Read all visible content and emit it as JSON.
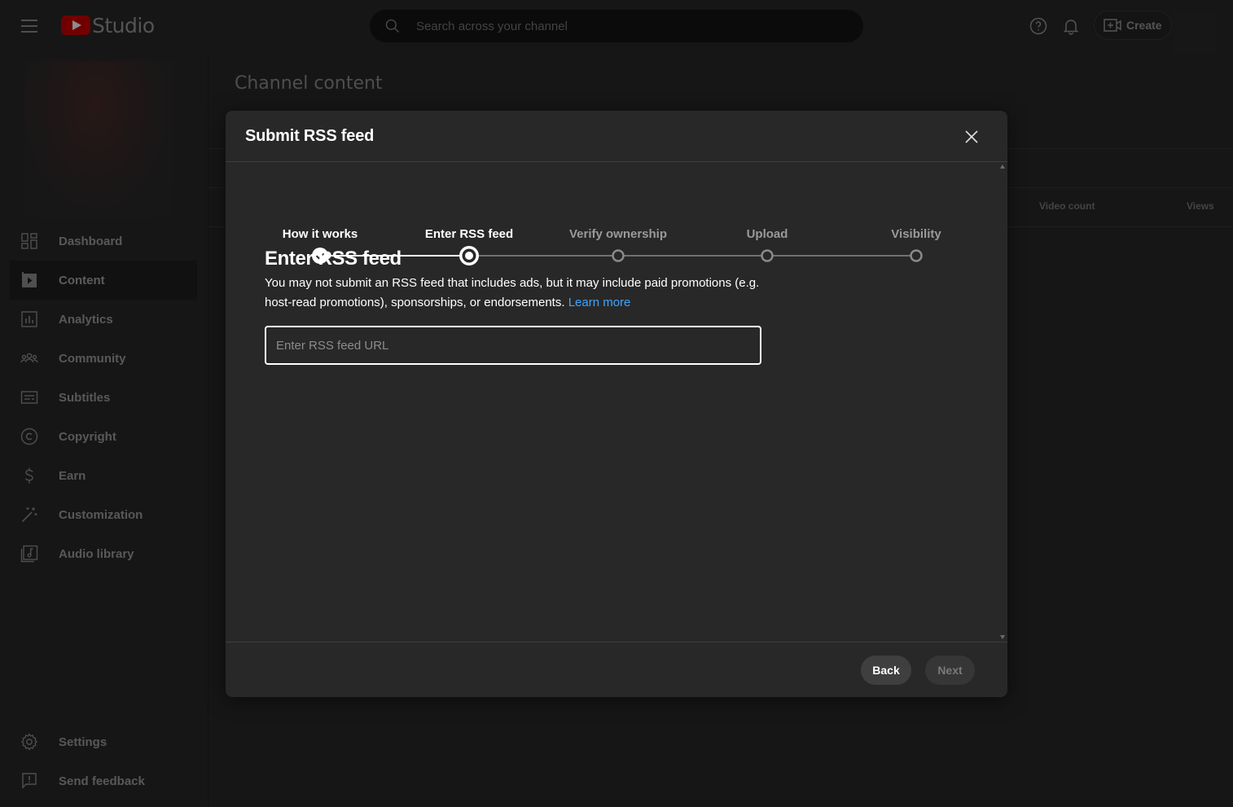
{
  "header": {
    "logo_text": "Studio",
    "search_placeholder": "Search across your channel",
    "create_label": "Create"
  },
  "sidebar": {
    "items": [
      {
        "label": "Dashboard",
        "icon": "dashboard-icon"
      },
      {
        "label": "Content",
        "icon": "content-icon",
        "active": true
      },
      {
        "label": "Analytics",
        "icon": "analytics-icon"
      },
      {
        "label": "Community",
        "icon": "community-icon"
      },
      {
        "label": "Subtitles",
        "icon": "subtitles-icon"
      },
      {
        "label": "Copyright",
        "icon": "copyright-icon"
      },
      {
        "label": "Earn",
        "icon": "dollar-icon"
      },
      {
        "label": "Customization",
        "icon": "magic-wand-icon"
      },
      {
        "label": "Audio library",
        "icon": "audio-library-icon"
      }
    ],
    "bottom": [
      {
        "label": "Settings",
        "icon": "gear-icon"
      },
      {
        "label": "Send feedback",
        "icon": "feedback-icon"
      }
    ]
  },
  "main": {
    "title": "Channel content",
    "columns": [
      "Video count",
      "Views"
    ]
  },
  "dialog": {
    "title": "Submit RSS feed",
    "steps": [
      {
        "label": "How it works",
        "state": "done"
      },
      {
        "label": "Enter RSS feed",
        "state": "current"
      },
      {
        "label": "Verify ownership",
        "state": "pending"
      },
      {
        "label": "Upload",
        "state": "pending"
      },
      {
        "label": "Visibility",
        "state": "pending"
      }
    ],
    "section_title": "Enter RSS feed",
    "description": "You may not submit an RSS feed that includes ads, but it may include paid promotions (e.g. host-read promotions), sponsorships, or endorsements.",
    "learn_more": "Learn more",
    "input_placeholder": "Enter RSS feed URL",
    "input_value": "",
    "back_label": "Back",
    "next_label": "Next"
  },
  "colors": {
    "background": "#282828",
    "accent_link": "#3ea6ff",
    "logo_red": "#cc0000"
  }
}
